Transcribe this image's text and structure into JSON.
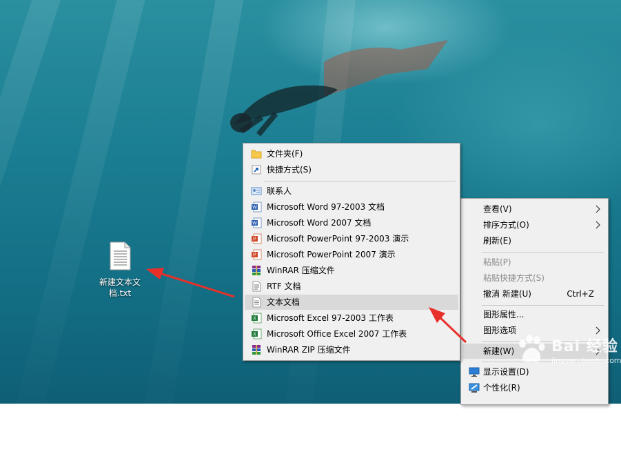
{
  "desktop": {
    "file_icon": {
      "label": "新建文本文档.txt",
      "icon": "text-file-icon"
    }
  },
  "context_menu": {
    "items": [
      {
        "label": "查看(V)",
        "submenu": true,
        "disabled": false
      },
      {
        "label": "排序方式(O)",
        "submenu": true,
        "disabled": false
      },
      {
        "label": "刷新(E)",
        "submenu": false,
        "disabled": false
      },
      {
        "label": "粘贴(P)",
        "submenu": false,
        "disabled": true
      },
      {
        "label": "粘贴快捷方式(S)",
        "submenu": false,
        "disabled": true
      },
      {
        "label": "撤消 新建(U)",
        "shortcut": "Ctrl+Z",
        "submenu": false,
        "disabled": false
      },
      {
        "label": "图形属性...",
        "submenu": false,
        "disabled": false
      },
      {
        "label": "图形选项",
        "submenu": true,
        "disabled": false
      },
      {
        "label": "新建(W)",
        "submenu": true,
        "disabled": false,
        "highlighted": true
      },
      {
        "label": "显示设置(D)",
        "icon": "display-icon",
        "disabled": false
      },
      {
        "label": "个性化(R)",
        "icon": "personalize-icon",
        "disabled": false
      }
    ]
  },
  "new_submenu": {
    "items": [
      {
        "label": "文件夹(F)",
        "icon": "folder-icon"
      },
      {
        "label": "快捷方式(S)",
        "icon": "shortcut-icon"
      },
      {
        "label": "联系人",
        "icon": "contact-icon"
      },
      {
        "label": "Microsoft Word 97-2003 文档",
        "icon": "word-icon"
      },
      {
        "label": "Microsoft Word 2007 文档",
        "icon": "word-icon"
      },
      {
        "label": "Microsoft PowerPoint 97-2003 演示",
        "icon": "powerpoint-icon"
      },
      {
        "label": "Microsoft PowerPoint 2007 演示",
        "icon": "powerpoint-icon"
      },
      {
        "label": "WinRAR 压缩文件",
        "icon": "winrar-icon"
      },
      {
        "label": "RTF 文档",
        "icon": "rtf-icon"
      },
      {
        "label": "文本文档",
        "icon": "text-document-icon",
        "highlighted": true
      },
      {
        "label": "Microsoft Excel 97-2003 工作表",
        "icon": "excel-icon"
      },
      {
        "label": "Microsoft Office Excel 2007 工作表",
        "icon": "excel-icon"
      },
      {
        "label": "WinRAR ZIP 压缩文件",
        "icon": "winrar-zip-icon"
      }
    ]
  },
  "watermark": {
    "brand": "Bai 经验",
    "url": "jingyan.baidu.com"
  },
  "colors": {
    "annotation_arrow": "#e8302a",
    "menu_bg": "#f0f0f0",
    "highlight": "#d9d9d9"
  }
}
